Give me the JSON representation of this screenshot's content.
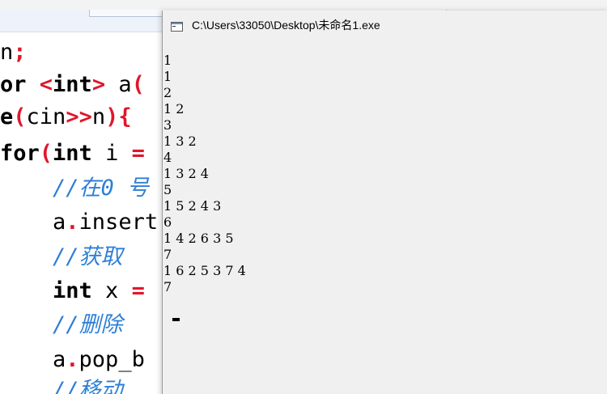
{
  "editor": {
    "code_lines": [
      {
        "segments": [
          {
            "t": "n",
            "c": "plain"
          },
          {
            "t": ";",
            "c": "red"
          }
        ]
      },
      {
        "segments": [
          {
            "t": "or ",
            "c": "bold"
          },
          {
            "t": "<",
            "c": "red"
          },
          {
            "t": "int",
            "c": "bold"
          },
          {
            "t": ">",
            "c": "red"
          },
          {
            "t": " a",
            "c": "plain"
          },
          {
            "t": "(",
            "c": "red"
          }
        ]
      },
      {
        "segments": [
          {
            "t": "e",
            "c": "bold"
          },
          {
            "t": "(",
            "c": "red"
          },
          {
            "t": "cin",
            "c": "plain"
          },
          {
            "t": ">>",
            "c": "red"
          },
          {
            "t": "n",
            "c": "plain"
          },
          {
            "t": "){",
            "c": "red"
          }
        ]
      },
      {
        "segments": [
          {
            "t": "for",
            "c": "bold"
          },
          {
            "t": "(",
            "c": "red"
          },
          {
            "t": "int",
            "c": "bold"
          },
          {
            "t": " i ",
            "c": "plain"
          },
          {
            "t": "=",
            "c": "red"
          }
        ]
      },
      {
        "segments": [
          {
            "t": "    //在0 号",
            "c": "cmt"
          }
        ]
      },
      {
        "segments": [
          {
            "t": "    a",
            "c": "plain"
          },
          {
            "t": ".",
            "c": "red"
          },
          {
            "t": "insert",
            "c": "plain"
          }
        ]
      },
      {
        "segments": [
          {
            "t": "    //获取",
            "c": "cmt"
          }
        ]
      },
      {
        "segments": [
          {
            "t": "    int",
            "c": "bold"
          },
          {
            "t": " x ",
            "c": "plain"
          },
          {
            "t": "=",
            "c": "red"
          }
        ]
      },
      {
        "segments": [
          {
            "t": "    //删除",
            "c": "cmt"
          }
        ]
      },
      {
        "segments": [
          {
            "t": "    a",
            "c": "plain"
          },
          {
            "t": ".",
            "c": "red"
          },
          {
            "t": "pop_b",
            "c": "plain"
          }
        ]
      },
      {
        "segments": [
          {
            "t": "    //移动",
            "c": "cmt"
          }
        ]
      }
    ]
  },
  "console": {
    "title": "C:\\Users\\33050\\Desktop\\未命名1.exe",
    "output_lines": [
      "1",
      "1",
      "2",
      "1 2",
      "3",
      "1 3 2",
      "4",
      "1 3 2 4",
      "5",
      "1 5 2 4 3",
      "6",
      "1 4 2 6 3 5",
      "7",
      "1 6 2 5 3 7 4",
      "7"
    ]
  }
}
